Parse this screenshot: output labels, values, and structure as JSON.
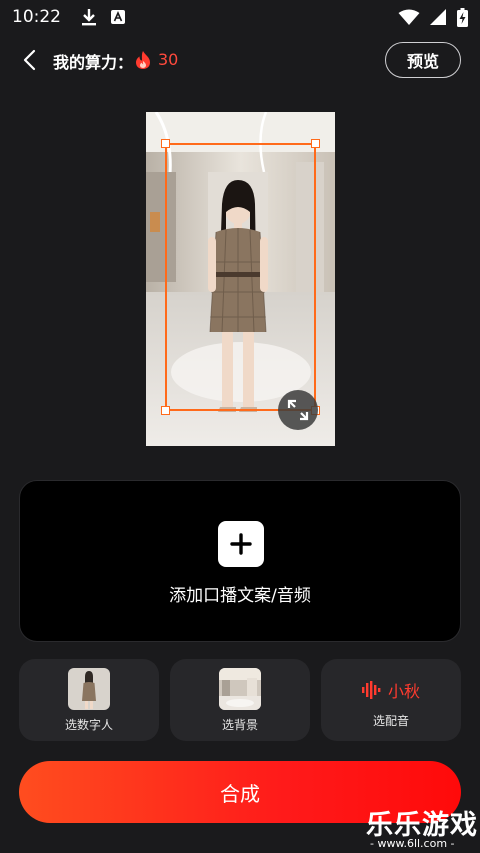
{
  "status_bar": {
    "time": "10:22",
    "left_icons": [
      "download-icon",
      "app-a-icon"
    ],
    "right_icons": [
      "wifi-icon",
      "signal-icon",
      "battery-charging-icon"
    ]
  },
  "header": {
    "compute_label": "我的算力：",
    "compute_icon": "fire-icon",
    "compute_value": "30",
    "preview_button": "预览"
  },
  "preview": {
    "subject": "digital-avatar-preview",
    "resize_icon": "expand-icon"
  },
  "add_script": {
    "icon": "plus-icon",
    "label": "添加口播文案/音频"
  },
  "options": [
    {
      "label": "选数字人",
      "thumb": "avatar-thumbnail"
    },
    {
      "label": "选背景",
      "thumb": "background-thumbnail"
    },
    {
      "label": "选配音",
      "voice_name": "小秋",
      "icon": "sound-wave-icon"
    }
  ],
  "compose_button": "合成",
  "watermark": {
    "title": "乐乐游戏",
    "url": "- www.6ll.com -"
  },
  "colors": {
    "background": "#1a1a1c",
    "accent": "#ff3b2f",
    "selection": "#ff6a1a",
    "compose_gradient_start": "#ff4d1f",
    "compose_gradient_end": "#ff0a0a"
  }
}
